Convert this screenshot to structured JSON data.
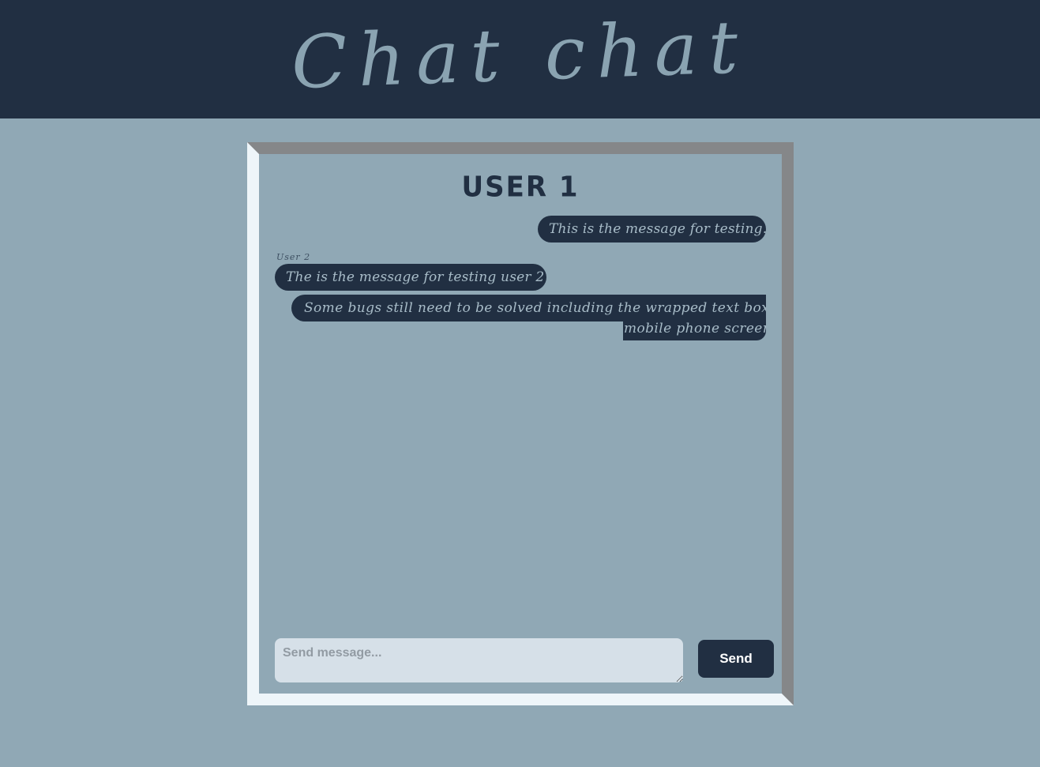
{
  "header": {
    "app_title": "Chat chat"
  },
  "chat": {
    "user_title": "USER 1",
    "messages": [
      {
        "text": "This is the message for testing."
      },
      {
        "sender": "User 2",
        "text": "The is the message for testing user 2"
      },
      {
        "text_line1": "Some bugs still need to be solved including the wrapped text box on the",
        "text_line2": "mobile phone screens."
      }
    ]
  },
  "composer": {
    "placeholder": "Send message...",
    "value": "",
    "send_label": "Send"
  },
  "colors": {
    "header_bg": "#212f42",
    "page_bg": "#90a8b5",
    "bubble_bg": "#212f42",
    "bubble_text": "#a8bcc8",
    "input_bg": "#d6e0e8"
  }
}
